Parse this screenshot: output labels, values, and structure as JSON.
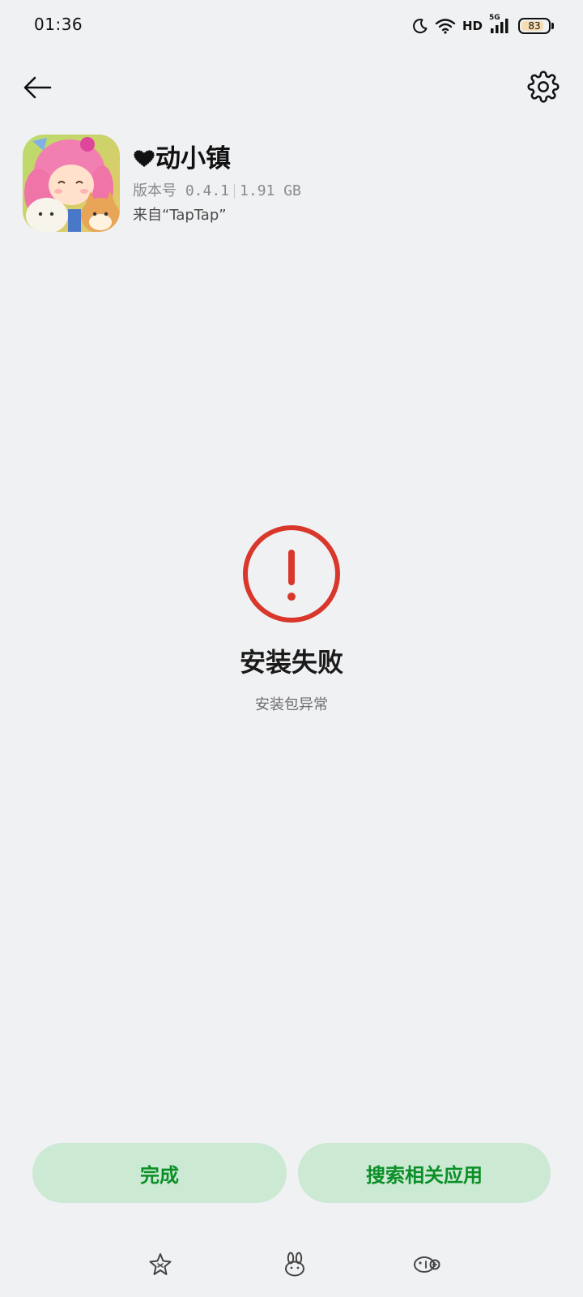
{
  "status_bar": {
    "time": "01:36",
    "icons": [
      "moon-icon",
      "wifi-icon",
      "hd-icon",
      "signal-5g-icon",
      "battery-icon"
    ],
    "hd_label": "HD",
    "network_label": "5G",
    "battery_level": "83",
    "battery_fraction": 0.83
  },
  "top_bar": {
    "back_icon": "arrow-left-icon",
    "settings_icon": "gear-icon"
  },
  "app": {
    "name": "动小镇",
    "name_prefix_icon": "heart-icon",
    "version_label": "版本号 0.4.1",
    "size_label": "1.91 GB",
    "source": "来自“TapTap”",
    "icon": "app-icon-image"
  },
  "result": {
    "icon": "error-exclamation-icon",
    "title": "安装失败",
    "subtitle": "安装包异常",
    "accent_color": "#d9372b"
  },
  "actions": {
    "done_label": "完成",
    "search_label": "搜索相关应用",
    "button_bg": "#cce9d3",
    "button_text_color": "#0a8f27"
  },
  "nav_bar": {
    "icons": [
      "star-sparkle-icon",
      "bunny-icon",
      "fish-icon"
    ]
  }
}
